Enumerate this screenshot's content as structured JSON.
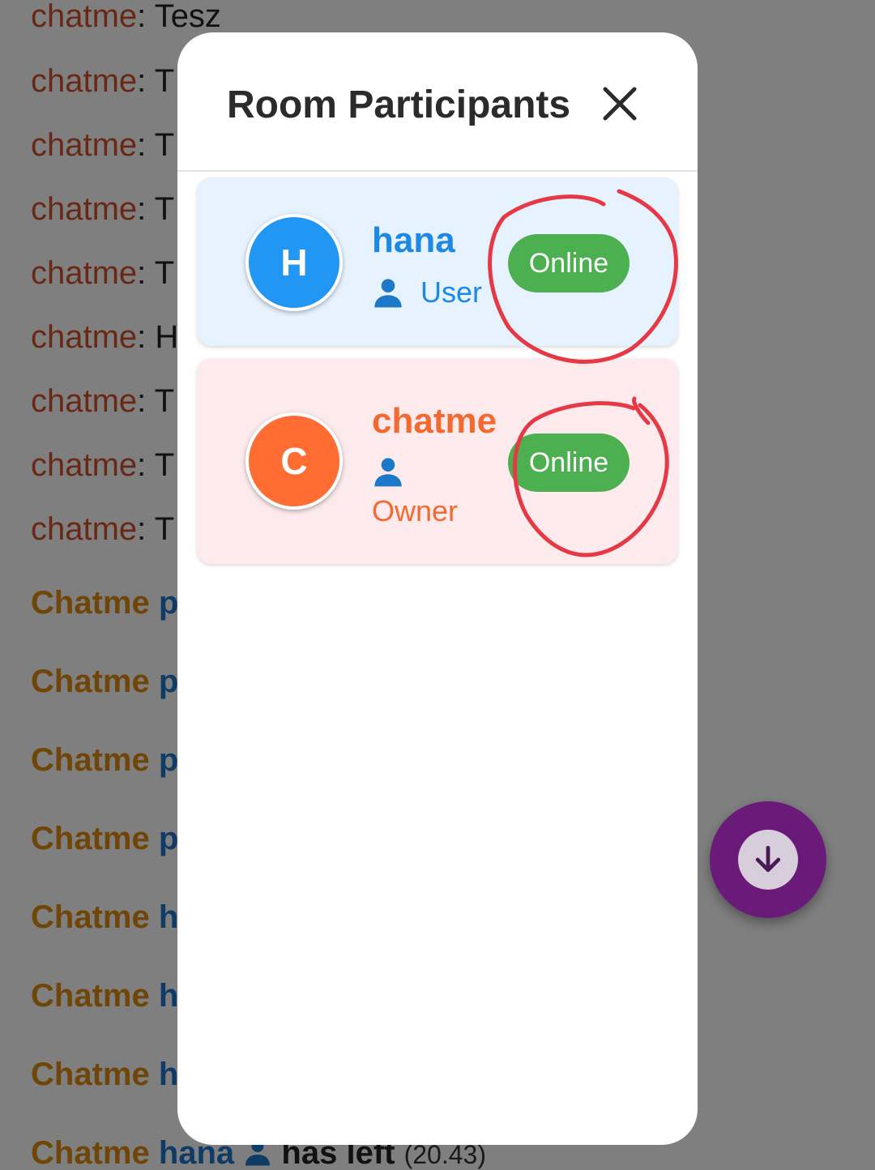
{
  "chat": {
    "messages": [
      {
        "sender": "chatme",
        "sep": ":",
        "text": " Tesz"
      },
      {
        "sender": "chatme",
        "sep": ":",
        "text": " T"
      },
      {
        "sender": "chatme",
        "sep": ":",
        "text": " T"
      },
      {
        "sender": "chatme",
        "sep": ":",
        "text": " T"
      },
      {
        "sender": "chatme",
        "sep": ":",
        "text": " T"
      },
      {
        "sender": "chatme",
        "sep": ":",
        "text": " H"
      },
      {
        "sender": "chatme",
        "sep": ":",
        "text": " T"
      },
      {
        "sender": "chatme",
        "sep": ":",
        "text": " T"
      },
      {
        "sender": "chatme",
        "sep": ":",
        "text": " T"
      }
    ],
    "system_messages": [
      {
        "name": "Chatme",
        "user": " p"
      },
      {
        "name": "Chatme",
        "user": " p"
      },
      {
        "name": "Chatme",
        "user": " p"
      },
      {
        "name": "Chatme",
        "user": " p"
      },
      {
        "name": "Chatme",
        "user": " h"
      },
      {
        "name": "Chatme",
        "user": " h"
      },
      {
        "name": "Chatme",
        "user": " h"
      }
    ],
    "last_system_message": {
      "name": "Chatme",
      "user": " hana",
      "action": " has left",
      "time": " (20.43)"
    }
  },
  "modal": {
    "title": "Room Participants",
    "close_icon": "close-icon",
    "participants": [
      {
        "initial": "H",
        "name": "hana",
        "role": "User",
        "status": "Online",
        "color": "#2196f3"
      },
      {
        "initial": "C",
        "name": "chatme",
        "role": "Owner",
        "status": "Online",
        "color": "#ff6d33"
      }
    ]
  },
  "colors": {
    "online_badge": "#4caf50",
    "user_card_bg": "#e6f2fd",
    "owner_card_bg": "#fdeaec",
    "annotation_stroke": "#e53945",
    "fab": "#6a1b7a"
  },
  "fab": {
    "icon": "arrow-down-icon"
  }
}
